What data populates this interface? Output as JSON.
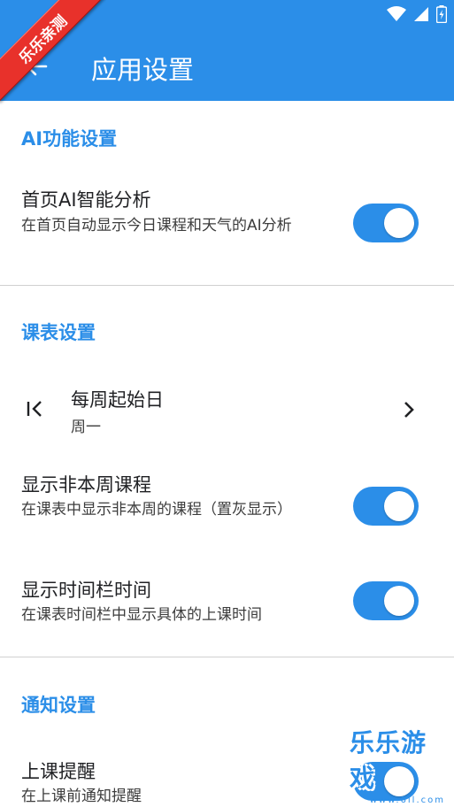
{
  "colors": {
    "accent": "#2b8ee8",
    "ribbon": "#e8312b"
  },
  "app_bar": {
    "title": "应用设置",
    "back_icon": "arrow-left-icon"
  },
  "status_bar": {
    "icons": [
      "wifi-icon",
      "signal-icon",
      "battery-icon"
    ]
  },
  "ribbon": {
    "text": "乐乐亲测"
  },
  "sections": {
    "ai": {
      "header": "AI功能设置",
      "home_ai": {
        "title": "首页AI智能分析",
        "subtitle": "在首页自动显示今日课程和天气的AI分析",
        "enabled": true
      }
    },
    "schedule": {
      "header": "课表设置",
      "week_start": {
        "title": "每周起始日",
        "value": "周一",
        "icon": "first-page-icon"
      },
      "show_non_week": {
        "title": "显示非本周课程",
        "subtitle": "在课表中显示非本周的课程（置灰显示）",
        "enabled": true
      },
      "show_time": {
        "title": "显示时间栏时间",
        "subtitle": "在课表时间栏中显示具体的上课时间",
        "enabled": true
      }
    },
    "notification": {
      "header": "通知设置",
      "class_reminder": {
        "title": "上课提醒",
        "subtitle": "在上课前通知提醒",
        "enabled": true
      }
    }
  },
  "watermark": {
    "text": "乐乐游戏",
    "url": "www.6ll.com"
  }
}
